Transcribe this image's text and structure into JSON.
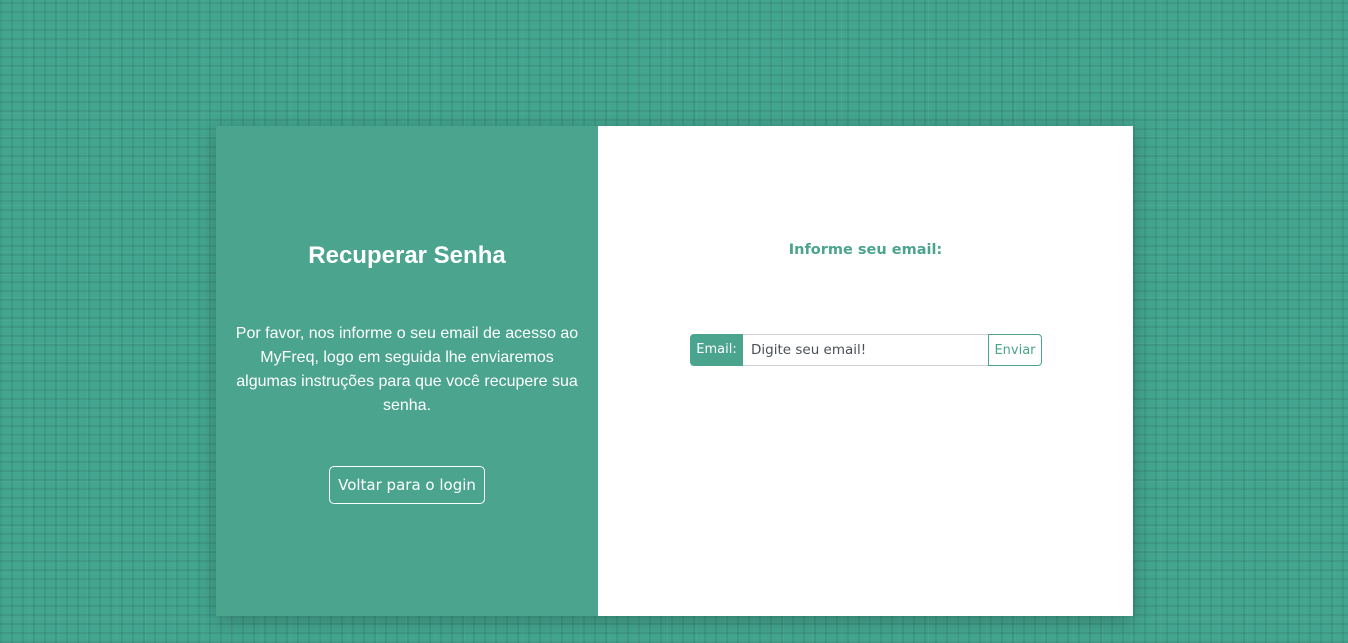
{
  "left": {
    "title": "Recuperar Senha",
    "description": "Por favor, nos informe o seu email de acesso ao MyFreq, logo em seguida lhe enviaremos algumas instruções para que você recupere sua senha.",
    "back_label": "Voltar para o login"
  },
  "right": {
    "title": "Informe seu email:",
    "email_label": "Email:",
    "email_placeholder": "Digite seu email!",
    "email_value": "",
    "send_label": "Enviar"
  },
  "colors": {
    "accent": "#4aa48e",
    "background": "#43a58f",
    "panel": "#ffffff"
  }
}
